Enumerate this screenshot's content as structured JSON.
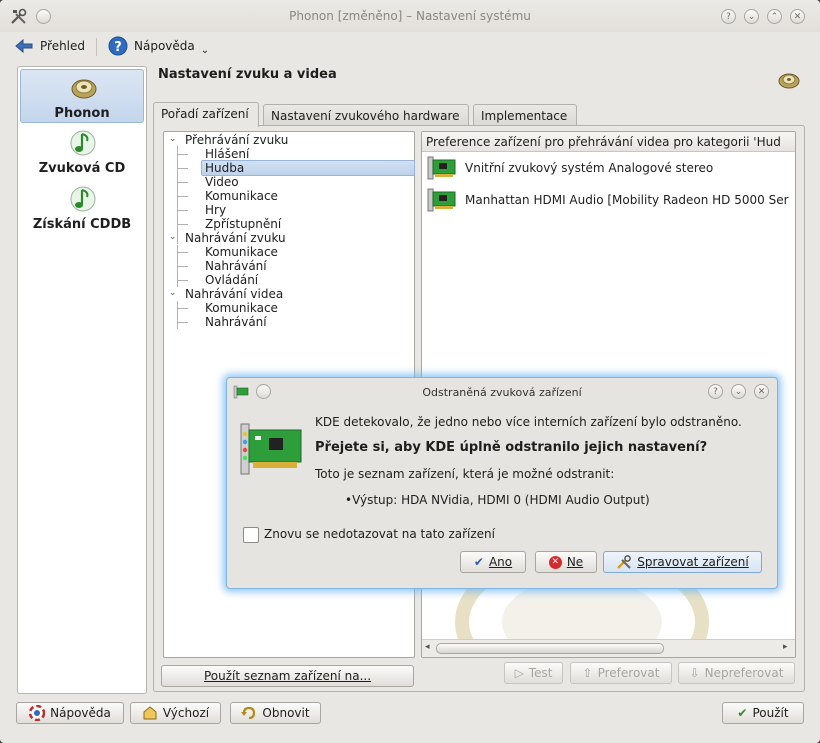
{
  "window": {
    "title": "Phonon [změněno] – Nastavení systému"
  },
  "toolbar": {
    "overview": "Přehled",
    "help": "Nápověda"
  },
  "sidebar": {
    "items": [
      {
        "label": "Phonon",
        "icon": "speaker-icon",
        "selected": true
      },
      {
        "label": "Zvuková CD",
        "icon": "music-note-icon",
        "selected": false
      },
      {
        "label": "Získání CDDB",
        "icon": "music-note-icon",
        "selected": false
      }
    ]
  },
  "content": {
    "title": "Nastavení zvuku a videa",
    "tabs": [
      "Pořadí zařízení",
      "Nastavení zvukového hardware",
      "Implementace"
    ],
    "tree": {
      "g1": "Přehrávání zvuku",
      "g1_items": [
        "Hlášení",
        "Hudba",
        "Video",
        "Komunikace",
        "Hry",
        "Zpřístupnění"
      ],
      "g2": "Nahrávání zvuku",
      "g2_items": [
        "Komunikace",
        "Nahrávání",
        "Ovládání"
      ],
      "g3": "Nahrávání videa",
      "g3_items": [
        "Komunikace",
        "Nahrávání"
      ]
    },
    "device_header": "Preference zařízení pro přehrávání videa pro kategorii 'Hud",
    "devices": [
      "Vnitřní zvukový systém Analogové stereo",
      "Manhattan HDMI Audio [Mobility Radeon HD 5000 Ser"
    ],
    "use_list_button": "Použít seznam zařízení na...",
    "test_button": "Test",
    "prefer_button": "Preferovat",
    "defer_button": "Nepreferovat"
  },
  "footer": {
    "help": "Nápověda",
    "defaults": "Výchozí",
    "reset": "Obnovit",
    "apply": "Použít"
  },
  "dialog": {
    "title": "Odstraněná zvuková zařízení",
    "line1": "KDE detekovalo, že jedno nebo více interních zařízení bylo odstraněno.",
    "question": "Přejete si, aby KDE úplně odstranilo jejich nastavení?",
    "line3": "Toto je seznam zařízení, která je možné odstranit:",
    "device": "Výstup: HDA NVidia, HDMI 0 (HDMI Audio Output)",
    "checkbox": "Znovu se nedotazovat na tato zařízení",
    "yes": "Ano",
    "no": "Ne",
    "manage": "Spravovat zařízení"
  },
  "colors": {
    "selection": "#c4d6ec",
    "dialog_glow": "#6eb4f0"
  }
}
